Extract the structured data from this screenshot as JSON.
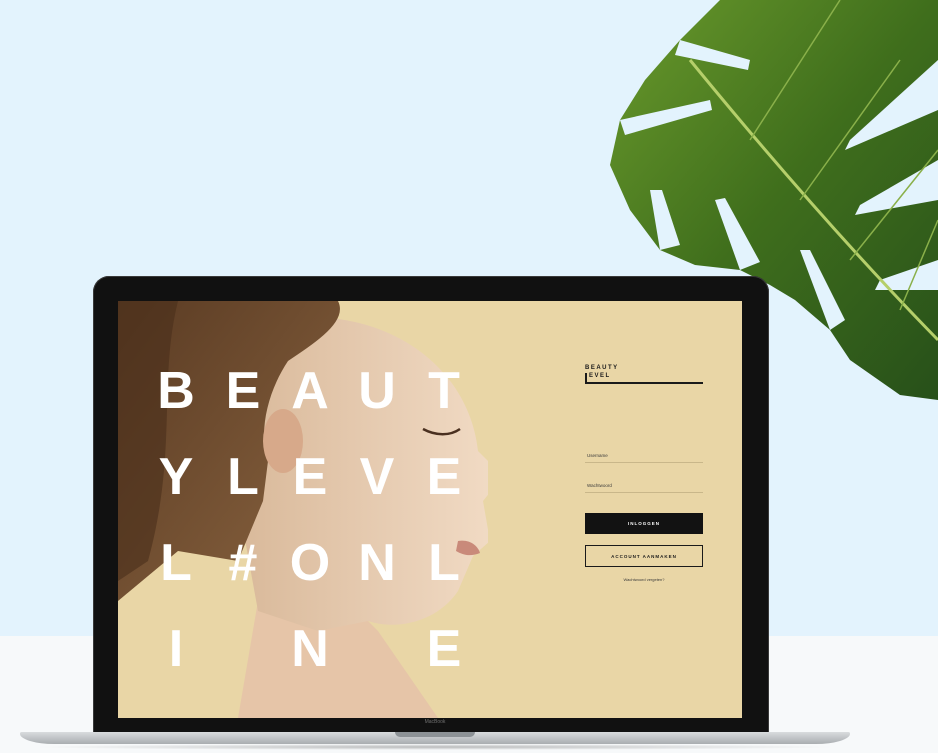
{
  "hero": {
    "letters": [
      "B",
      "E",
      "A",
      "U",
      "T",
      "Y",
      "L",
      "E",
      "V",
      "E",
      "L",
      "#",
      "O",
      "N",
      "L",
      "I",
      "N",
      "E"
    ]
  },
  "brand": {
    "line1": "BEAUTY",
    "line2": "EVEL"
  },
  "login": {
    "username_placeholder": "Username",
    "password_placeholder": "Wachtwoord",
    "login_button": "INLOGGEN",
    "create_button": "ACCOUNT AANMAKEN",
    "forgot_link": "Wachtwoord vergeten?"
  },
  "device": {
    "model_label": "MacBook"
  },
  "colors": {
    "background": "#e3f3fd",
    "screen_background": "#e9d6a6",
    "button_dark": "#121212"
  },
  "icons": [
    "monstera-leaf-icon",
    "brand-logo-icon"
  ]
}
